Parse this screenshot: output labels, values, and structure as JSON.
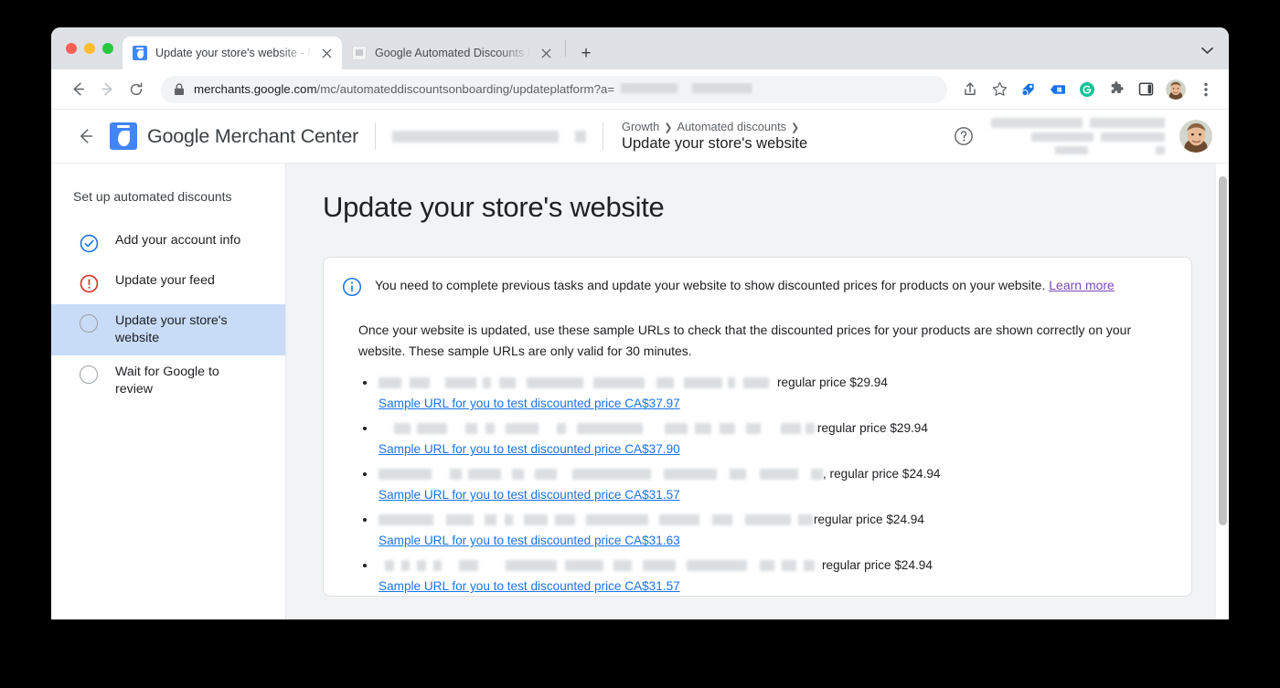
{
  "browser": {
    "tabs": [
      {
        "title": "Update your store's website - M",
        "favicon": "merchant-center-favicon",
        "active": true
      },
      {
        "title": "Google Automated Discounts fo",
        "favicon": "generic-page-favicon",
        "active": false
      }
    ],
    "new_tab_label": "+",
    "url": {
      "host": "merchants.google.com",
      "path": "/mc/automateddiscountsonboarding/updateplatform?a=",
      "redacted": true
    },
    "toolbar_icons": [
      "share-icon",
      "bookmark-star-icon",
      "tag-extension-icon",
      "badge-extension-icon",
      "grammarly-extension-icon",
      "puzzle-extensions-icon",
      "side-panel-icon",
      "profile-avatar",
      "chrome-menu-icon"
    ],
    "accent_colors": {
      "tab_strip": "#dee1e6",
      "omnibox": "#f1f3f4",
      "link": "#1a73e8"
    }
  },
  "app_header": {
    "back_label": "←",
    "brand_google": "Google",
    "brand_product": " Merchant Center",
    "breadcrumb": [
      "Growth",
      "Automated discounts"
    ],
    "breadcrumb_separator": "❯",
    "page_title": "Update your store's website",
    "help_icon": "help-circle-icon"
  },
  "sidebar": {
    "title": "Set up automated discounts",
    "items": [
      {
        "label": "Add your account info",
        "state": "complete",
        "icon": "check-circle-icon"
      },
      {
        "label": "Update your feed",
        "state": "error",
        "icon": "error-circle-icon"
      },
      {
        "label": "Update your store's website",
        "state": "current",
        "icon": "empty-circle-icon"
      },
      {
        "label": "Wait for Google to review",
        "state": "pending",
        "icon": "empty-circle-icon"
      }
    ]
  },
  "main": {
    "title": "Update your store's website",
    "alert": {
      "icon": "info-circle-icon",
      "text": "You need to complete previous tasks and update your website to show discounted prices for products on your website.",
      "link_label": "Learn more",
      "link_color": "#7b49b8"
    },
    "intro": "Once your website is updated, use these sample URLs to check that the discounted prices for your products are shown correctly on your website. These sample URLs are only valid for 30 minutes.",
    "items": [
      {
        "regular_price_label": "regular price $29.94",
        "link_label": "Sample URL for you to test discounted price CA$37.97",
        "product_redacted": true,
        "comma": false
      },
      {
        "regular_price_label": "regular price $29.94",
        "link_label": "Sample URL for you to test discounted price CA$37.90",
        "product_redacted": true,
        "comma": false
      },
      {
        "regular_price_label": ", regular price $24.94",
        "link_label": "Sample URL for you to test discounted price CA$31.57",
        "product_redacted": true,
        "comma": true
      },
      {
        "regular_price_label": "regular price $24.94",
        "link_label": "Sample URL for you to test discounted price CA$31.63",
        "product_redacted": true,
        "comma": false
      },
      {
        "regular_price_label": "regular price $24.94",
        "link_label": "Sample URL for you to test discounted price CA$31.57",
        "product_redacted": true,
        "comma": false
      }
    ]
  }
}
